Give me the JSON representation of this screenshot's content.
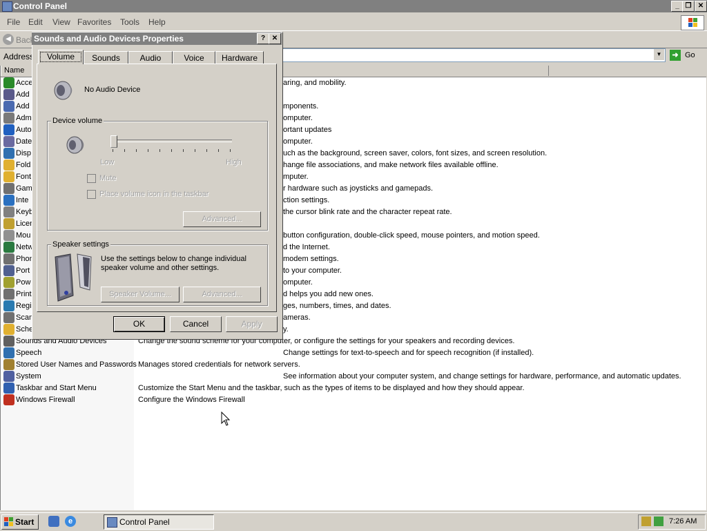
{
  "window": {
    "title": "Control Panel",
    "min": "_",
    "max": "❐",
    "close": "✕"
  },
  "menu": [
    "File",
    "Edit",
    "View",
    "Favorites",
    "Tools",
    "Help"
  ],
  "toolbar": {
    "back": "Back"
  },
  "address": {
    "label": "Address",
    "go": "Go"
  },
  "columns": {
    "name": "Name",
    "comments": ""
  },
  "rows": [
    {
      "name": "Accessibility Options",
      "short": "Acce",
      "comment": "aring, and mobility.",
      "color": "#2a8a2a"
    },
    {
      "name": "Add Hardware",
      "short": "Add",
      "comment": "",
      "color": "#5a5a8a"
    },
    {
      "name": "Add or Remove Programs",
      "short": "Add",
      "comment": "mponents.",
      "color": "#4a6ab0"
    },
    {
      "name": "Administrative Tools",
      "short": "Adm",
      "comment": "omputer.",
      "color": "#7a7a7a"
    },
    {
      "name": "Automatic Updates",
      "short": "Auto",
      "comment": "ortant updates",
      "color": "#2060c0"
    },
    {
      "name": "Date and Time",
      "short": "Date",
      "comment": "omputer.",
      "color": "#6a6aa0"
    },
    {
      "name": "Display",
      "short": "Disp",
      "comment": "uch as the background, screen saver, colors, font sizes, and screen resolution.",
      "color": "#3070b0"
    },
    {
      "name": "Folder Options",
      "short": "Fold",
      "comment": "hange file associations, and make network files available offline.",
      "color": "#e0b030"
    },
    {
      "name": "Fonts",
      "short": "Font",
      "comment": "mputer.",
      "color": "#e0b030"
    },
    {
      "name": "Game Controllers",
      "short": "Gam",
      "comment": "r hardware such as joysticks and gamepads.",
      "color": "#707070"
    },
    {
      "name": "Internet Options",
      "short": "Inte",
      "comment": "ction settings.",
      "color": "#2a70c0"
    },
    {
      "name": "Keyboard",
      "short": "Keyb",
      "comment": "the cursor blink rate and the character repeat rate.",
      "color": "#808080"
    },
    {
      "name": "Licensing",
      "short": "Licen",
      "comment": "",
      "color": "#c0a030"
    },
    {
      "name": "Mouse",
      "short": "Mou",
      "comment": "button configuration, double-click speed, mouse pointers, and motion speed.",
      "color": "#909090"
    },
    {
      "name": "Network Connections",
      "short": "Netw",
      "comment": "d the Internet.",
      "color": "#2a7a40"
    },
    {
      "name": "Phone and Modem Options",
      "short": "Phon",
      "comment": "modem settings.",
      "color": "#707070"
    },
    {
      "name": "Portable Media Devices",
      "short": "Port",
      "comment": "to your computer.",
      "color": "#506090"
    },
    {
      "name": "Power Options",
      "short": "Pow",
      "comment": "omputer.",
      "color": "#a0a030"
    },
    {
      "name": "Printers and Faxes",
      "short": "Print",
      "comment": "d helps you add new ones.",
      "color": "#707070"
    },
    {
      "name": "Regional and Language Options",
      "short": "Regi",
      "comment": "ges, numbers, times, and dates.",
      "color": "#2a7ab0"
    },
    {
      "name": "Scanners and Cameras",
      "short": "Scan",
      "comment": "ameras.",
      "color": "#707070"
    },
    {
      "name": "Scheduled Tasks",
      "short": "Sche",
      "comment": "y.",
      "color": "#e0b030"
    },
    {
      "name": "Sounds and Audio Devices",
      "short": "Sounds and Audio Devices",
      "comment": "Change the sound scheme for your computer, or configure the settings for your speakers and recording devices.",
      "color": "#606060"
    },
    {
      "name": "Speech",
      "short": "Speech",
      "comment": "Change settings for text-to-speech and for speech recognition (if installed).",
      "color": "#3070b0"
    },
    {
      "name": "Stored User Names and Passwords",
      "short": "Stored User Names and Passwords",
      "comment": "Manages stored credentials for network servers.",
      "color": "#a08030"
    },
    {
      "name": "System",
      "short": "System",
      "comment": "See information about your computer system, and change settings for hardware, performance, and automatic updates.",
      "color": "#5060a0"
    },
    {
      "name": "Taskbar and Start Menu",
      "short": "Taskbar and Start Menu",
      "comment": "Customize the Start Menu and the taskbar, such as the types of items to be displayed and how they should appear.",
      "color": "#3060b0"
    },
    {
      "name": "Windows Firewall",
      "short": "Windows Firewall",
      "comment": "Configure the Windows Firewall",
      "color": "#c03020"
    }
  ],
  "dialog": {
    "title": "Sounds and Audio Devices Properties",
    "help": "?",
    "close": "✕",
    "tabs": [
      "Volume",
      "Sounds",
      "Audio",
      "Voice",
      "Hardware"
    ],
    "device_name": "No Audio Device",
    "device_volume_label": "Device volume",
    "low": "Low",
    "high": "High",
    "volume_level": 0,
    "mute": "Mute",
    "place_icon": "Place volume icon in the taskbar",
    "advanced": "Advanced...",
    "speaker_settings_label": "Speaker settings",
    "speaker_text": "Use the settings below to change individual speaker volume and other settings.",
    "speaker_volume": "Speaker Volume...",
    "speaker_advanced": "Advanced...",
    "ok": "OK",
    "cancel": "Cancel",
    "apply": "Apply"
  },
  "taskbar": {
    "start": "Start",
    "item": "Control Panel",
    "time": "7:26 AM"
  },
  "icons": [
    "back-icon",
    "go-arrow-icon",
    "windows-logo-icon",
    "speaker-icon",
    "ie-icon"
  ]
}
